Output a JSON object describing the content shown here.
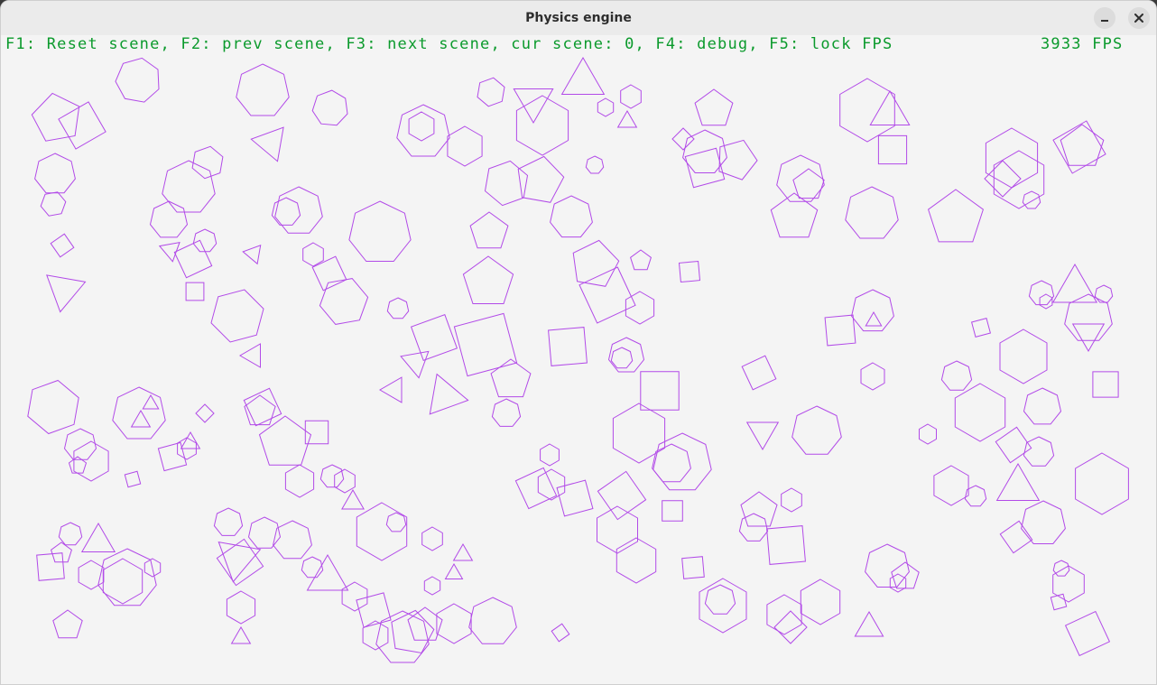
{
  "window": {
    "title": "Physics engine",
    "minimize_icon": "minimize-icon",
    "close_icon": "close-icon"
  },
  "hud": {
    "help_text": "F1: Reset scene, F2: prev scene, F3: next scene, cur scene: 0, F4: debug, F5: lock FPS",
    "fps_text": "3933 FPS",
    "text_color": "#0b9a2c"
  },
  "scene": {
    "shape_color": "#b24ae8",
    "background": "#f4f4f4"
  }
}
